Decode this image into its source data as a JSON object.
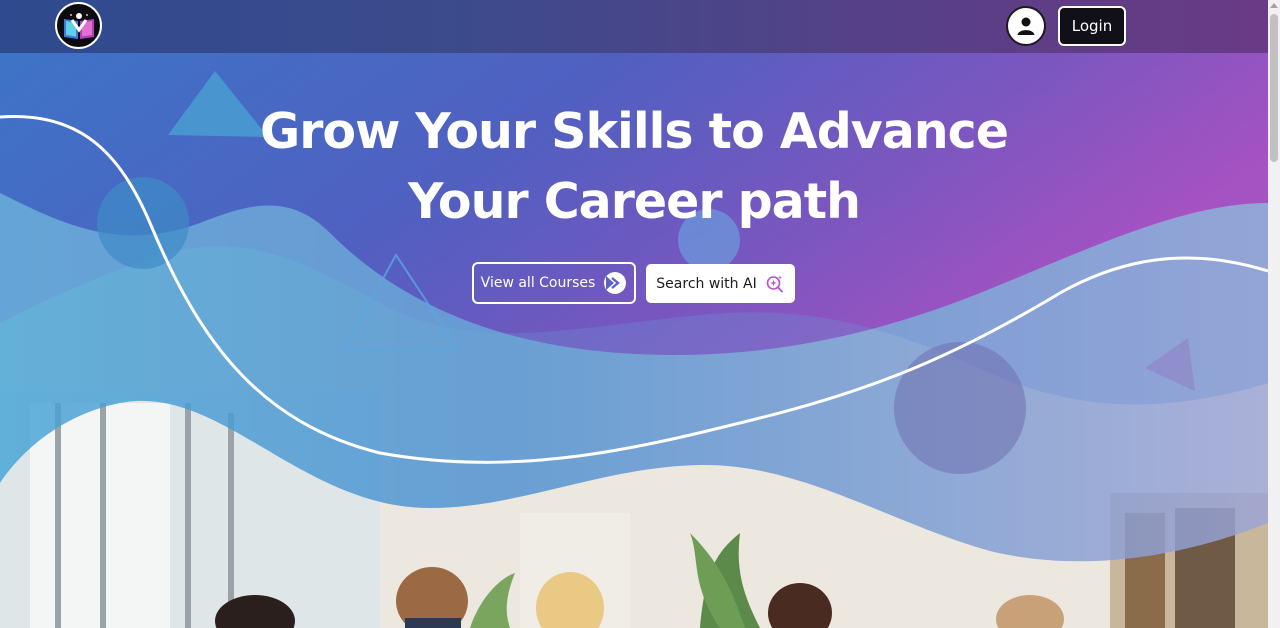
{
  "header": {
    "logo_name": "book-person-logo-icon",
    "user_icon": "user-icon",
    "login_label": "Login"
  },
  "hero": {
    "headline_line1": "Grow Your Skills to Advance",
    "headline_line2": "Your Career path",
    "view_courses_label": "View all Courses",
    "view_courses_icon": "arrow-circle-right-icon",
    "search_ai_label": "Search with AI",
    "search_ai_icon": "sparkle-search-icon"
  },
  "colors": {
    "hero_blue": "#3f63c4",
    "hero_purple": "#a24ec2",
    "login_bg": "#111018",
    "ai_icon_accent": "#b64fd0"
  }
}
